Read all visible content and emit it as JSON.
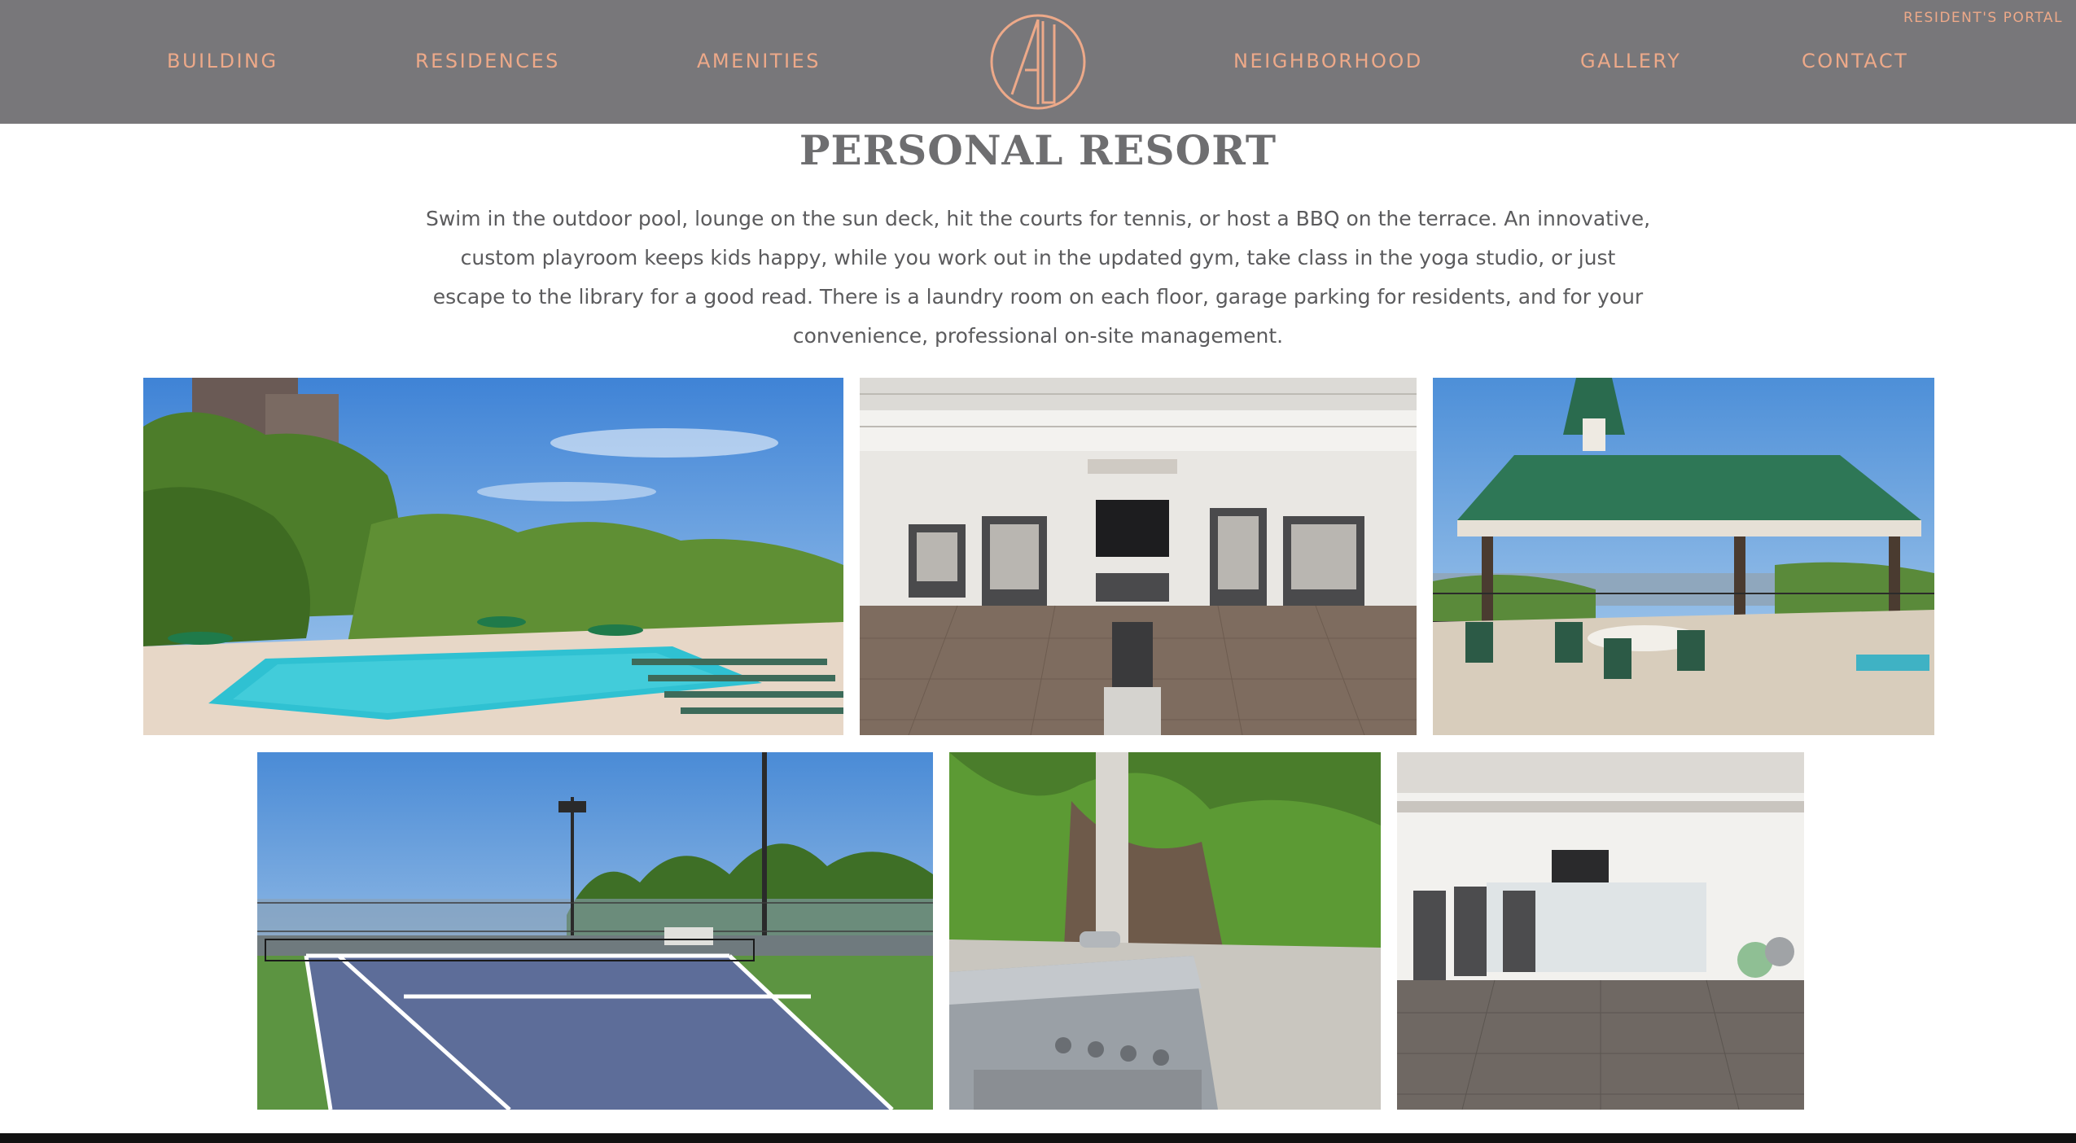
{
  "header": {
    "nav_left": [
      "BUILDING",
      "RESIDENCES",
      "AMENITIES"
    ],
    "nav_right": [
      "NEIGHBORHOOD",
      "GALLERY",
      "CONTACT"
    ],
    "portal_label": "RESIDENT'S PORTAL",
    "logo_icon": "monogram-logo-icon"
  },
  "intro": {
    "title": "PERSONAL RESORT",
    "description": "Swim in the outdoor pool, lounge on the sun deck, hit the courts for tennis, or host a BBQ on the terrace. An innovative, custom playroom keeps kids happy, while you work out in the updated gym, take class in the yoga studio, or just escape to the library for a good read. There is a laundry room on each floor, garage parking for residents, and for your convenience, professional on-site management."
  },
  "gallery": {
    "photos": [
      {
        "subject": "outdoor-pool"
      },
      {
        "subject": "gym"
      },
      {
        "subject": "gazebo-terrace"
      },
      {
        "subject": "tennis-court"
      },
      {
        "subject": "bbq-grill"
      },
      {
        "subject": "fitness-room"
      }
    ]
  },
  "colors": {
    "header_bg": "#78777a",
    "accent": "#eda989",
    "title": "#6e6e70",
    "body_text": "#5b5b5d"
  }
}
